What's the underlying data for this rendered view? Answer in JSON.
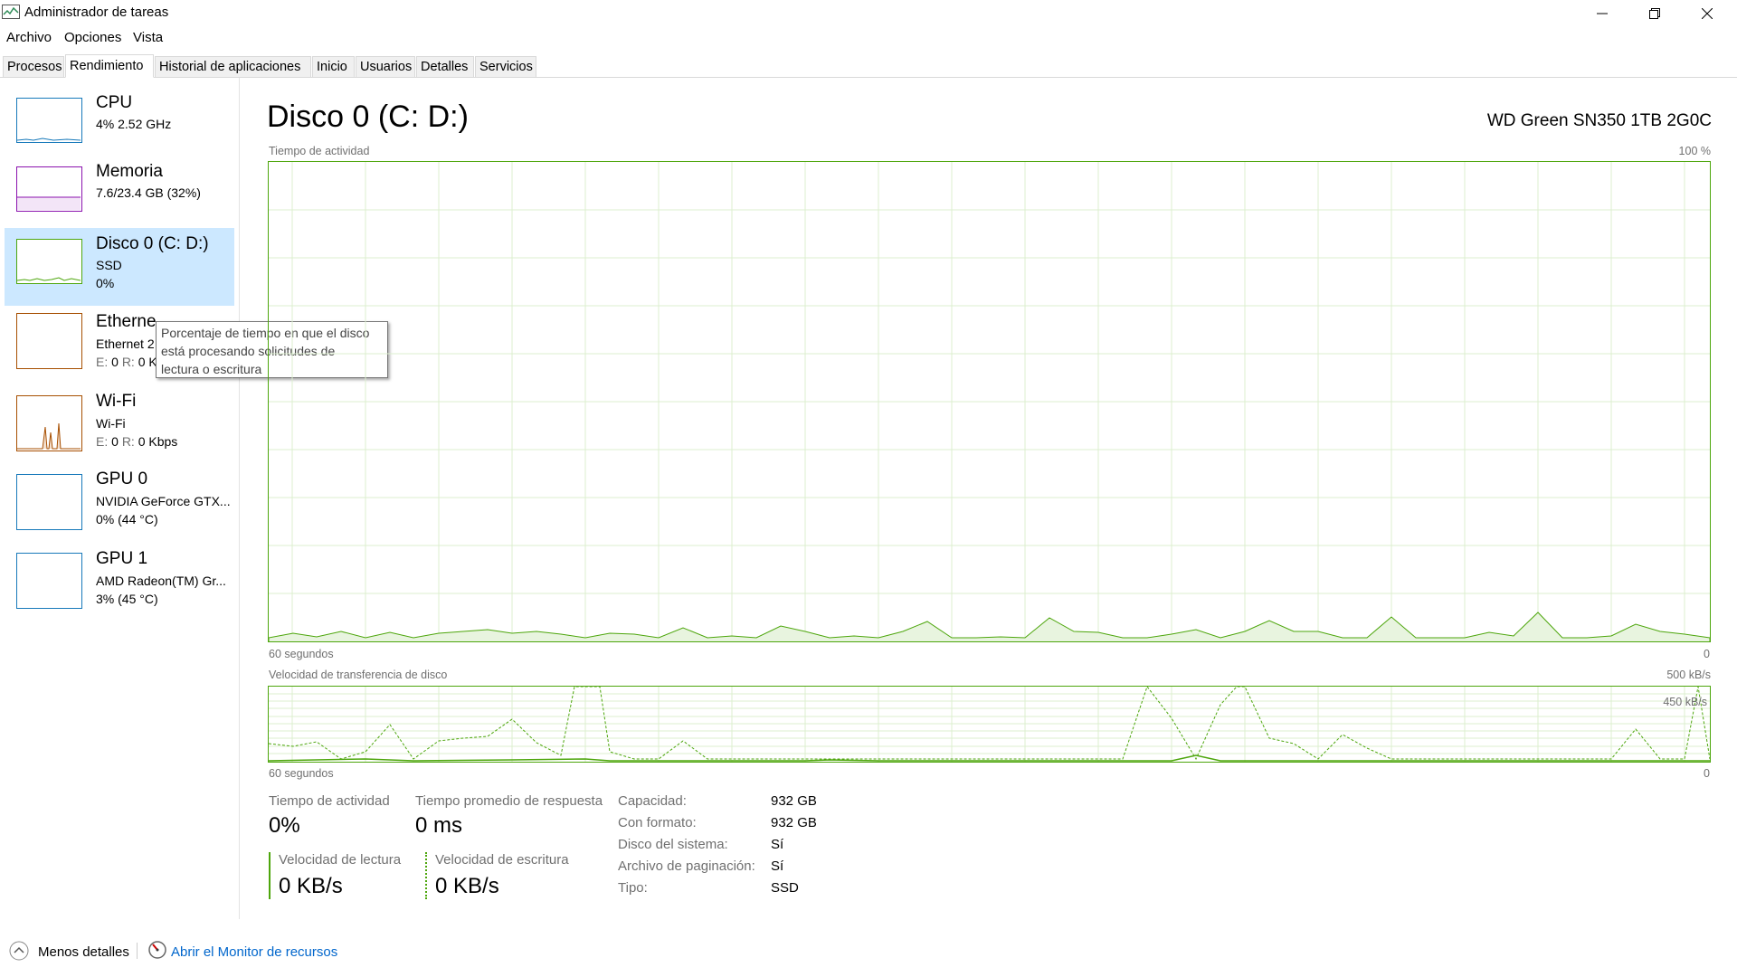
{
  "window": {
    "title": "Administrador de tareas"
  },
  "menu": [
    "Archivo",
    "Opciones",
    "Vista"
  ],
  "tabs": [
    "Procesos",
    "Rendimiento",
    "Historial de aplicaciones",
    "Inicio",
    "Usuarios",
    "Detalles",
    "Servicios"
  ],
  "sidebar": {
    "cpu": {
      "name": "CPU",
      "line1": "4%  2.52 GHz"
    },
    "memory": {
      "name": "Memoria",
      "line1": "7.6/23.4 GB (32%)"
    },
    "disk": {
      "name": "Disco 0 (C: D:)",
      "line1": "SSD",
      "line2": "0%"
    },
    "ethernet": {
      "name": "Etherne",
      "line1": "Ethernet 2",
      "line2_prefix_e": "E:",
      "line2_e": "0",
      "line2_prefix_r": "R:",
      "line2_r": "0 K"
    },
    "wifi": {
      "name": "Wi-Fi",
      "line1": "Wi-Fi",
      "line2_prefix_e": "E:",
      "line2_e": "0",
      "line2_prefix_r": "R:",
      "line2_r": "0 Kbps"
    },
    "gpu0": {
      "name": "GPU 0",
      "line1": "NVIDIA GeForce GTX...",
      "line2": "0%  (44 °C)"
    },
    "gpu1": {
      "name": "GPU 1",
      "line1": "AMD Radeon(TM) Gr...",
      "line2": "3%  (45 °C)"
    }
  },
  "tooltip": {
    "line1": "Porcentaje de tiempo en que el disco",
    "line2": "está procesando solicitudes de",
    "line3": "lectura o escritura"
  },
  "main": {
    "title": "Disco 0 (C: D:)",
    "device": "WD Green SN350 1TB 2G0C",
    "chart1": {
      "label": "Tiempo de actividad",
      "max": "100 %",
      "xleft": "60 segundos",
      "xright": "0"
    },
    "chart2": {
      "label": "Velocidad de transferencia de disco",
      "max": "500 kB/s",
      "inner": "450 kB/s",
      "xleft": "60 segundos",
      "xright": "0"
    }
  },
  "stats": {
    "active_label": "Tiempo de actividad",
    "active_value": "0%",
    "response_label": "Tiempo promedio de respuesta",
    "response_value": "0 ms",
    "read_label": "Velocidad de lectura",
    "read_value": "0 KB/s",
    "write_label": "Velocidad de escritura",
    "write_value": "0 KB/s"
  },
  "info": [
    {
      "label": "Capacidad:",
      "value": "932 GB"
    },
    {
      "label": "Con formato:",
      "value": "932 GB"
    },
    {
      "label": "Disco del sistema:",
      "value": "Sí"
    },
    {
      "label": "Archivo de paginación:",
      "value": "Sí"
    },
    {
      "label": "Tipo:",
      "value": "SSD"
    }
  ],
  "footer": {
    "less_details": "Menos detalles",
    "resource_monitor": "Abrir el Monitor de recursos"
  },
  "colors": {
    "disk": "#4da60c",
    "cpu": "#1779ba",
    "memory": "#8b12ae",
    "network": "#a74f01",
    "accent_bg": "#cce8ff",
    "link": "#0066cc"
  }
}
